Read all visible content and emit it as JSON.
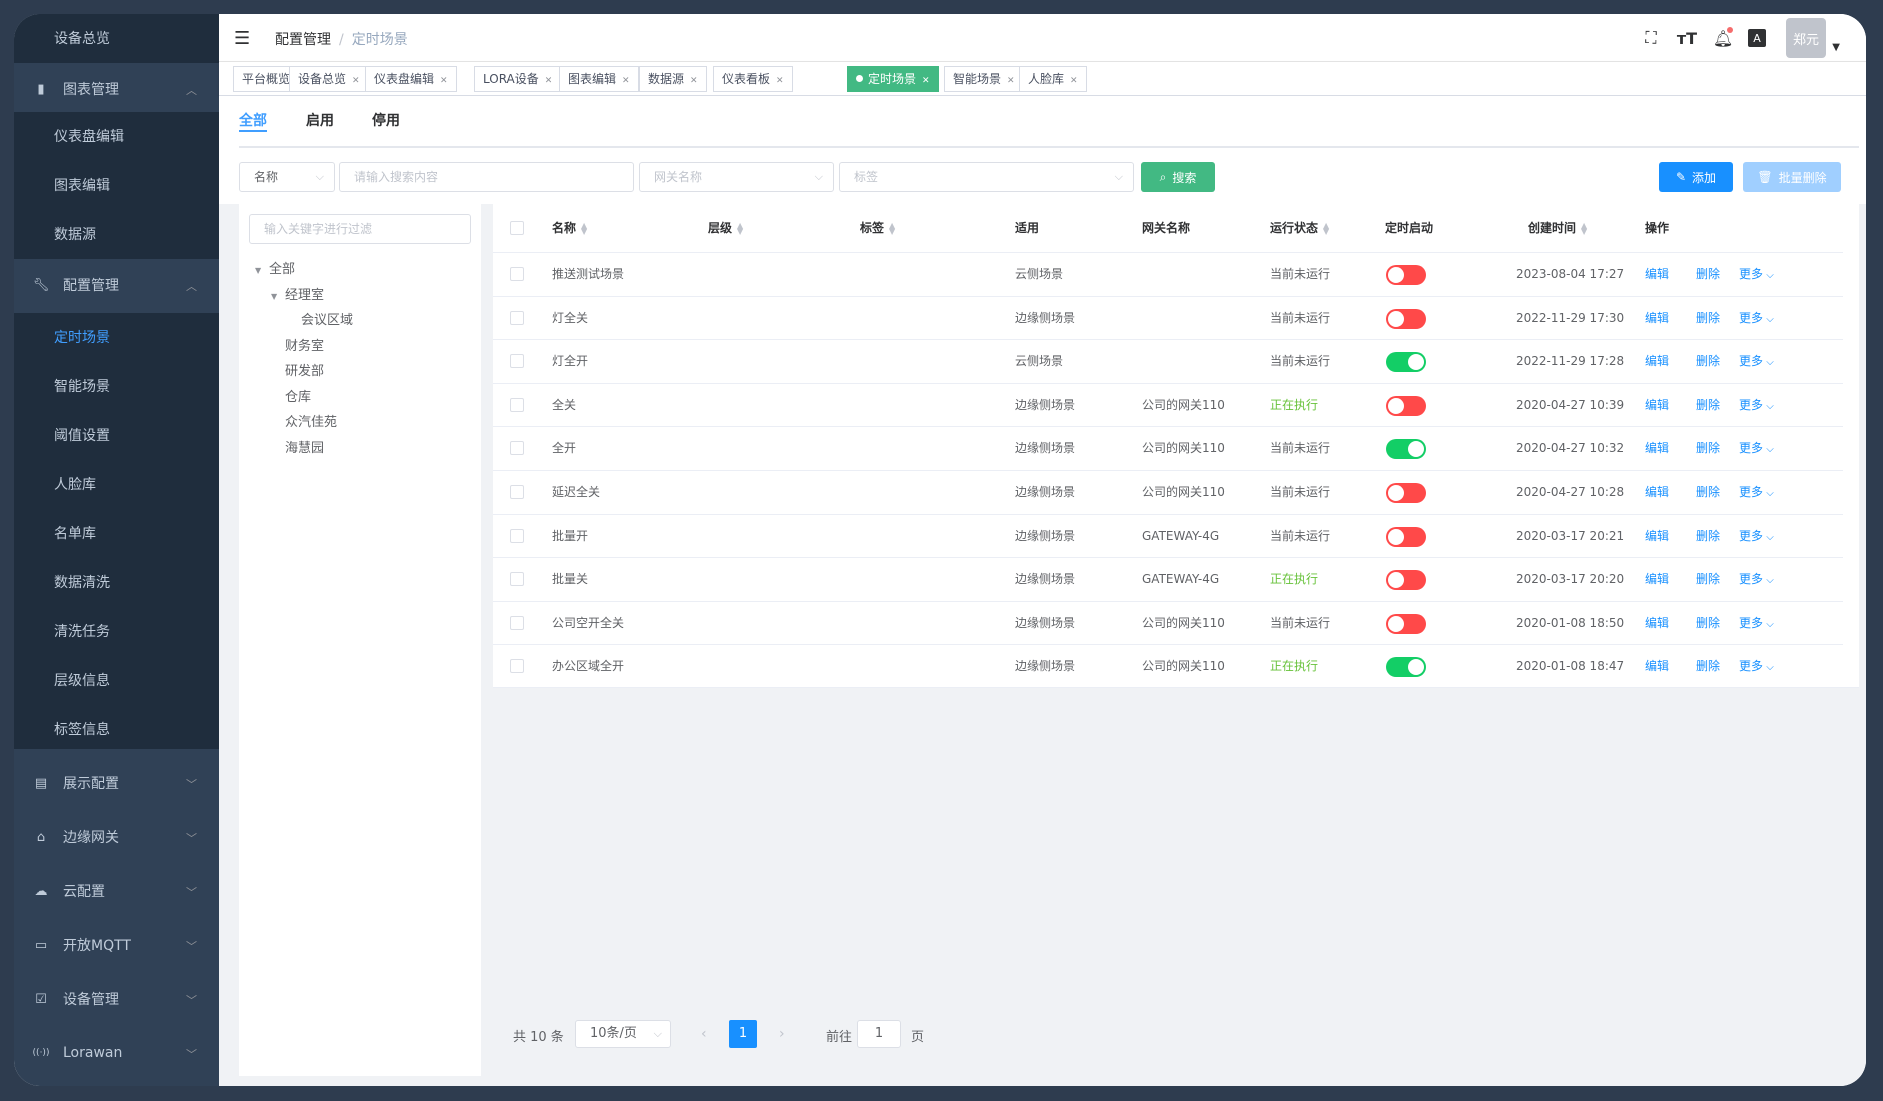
{
  "sidebar": {
    "items": [
      {
        "label": "设备总览",
        "type": "sub"
      },
      {
        "label": "图表管理",
        "type": "top",
        "icon": "bar-chart-icon",
        "expanded": true
      },
      {
        "label": "仪表盘编辑",
        "type": "sub"
      },
      {
        "label": "图表编辑",
        "type": "sub"
      },
      {
        "label": "数据源",
        "type": "sub"
      },
      {
        "label": "配置管理",
        "type": "top",
        "icon": "wrench-icon",
        "expanded": true
      },
      {
        "label": "定时场景",
        "type": "sub",
        "active": true
      },
      {
        "label": "智能场景",
        "type": "sub"
      },
      {
        "label": "阈值设置",
        "type": "sub"
      },
      {
        "label": "人脸库",
        "type": "sub"
      },
      {
        "label": "名单库",
        "type": "sub"
      },
      {
        "label": "数据清洗",
        "type": "sub"
      },
      {
        "label": "清洗任务",
        "type": "sub"
      },
      {
        "label": "层级信息",
        "type": "sub"
      },
      {
        "label": "标签信息",
        "type": "sub"
      },
      {
        "label": "展示配置",
        "type": "top",
        "icon": "display-icon",
        "expanded": false
      },
      {
        "label": "边缘网关",
        "type": "top",
        "icon": "router-icon",
        "expanded": false
      },
      {
        "label": "云配置",
        "type": "top",
        "icon": "cloud-icon",
        "expanded": false
      },
      {
        "label": "开放MQTT",
        "type": "top",
        "icon": "server-icon",
        "expanded": false
      },
      {
        "label": "设备管理",
        "type": "top",
        "icon": "device-check-icon",
        "expanded": false
      },
      {
        "label": "Lorawan",
        "type": "top",
        "icon": "signal-icon",
        "expanded": false
      }
    ]
  },
  "navbar": {
    "breadcrumb": [
      "配置管理",
      "定时场景"
    ],
    "user": "郑元"
  },
  "tags": [
    {
      "label": "平台概览",
      "closable": false
    },
    {
      "label": "设备总览",
      "closable": true
    },
    {
      "label": "仪表盘编辑",
      "closable": true
    },
    {
      "label": "LORA设备",
      "closable": true
    },
    {
      "label": "图表编辑",
      "closable": true
    },
    {
      "label": "数据源",
      "closable": true
    },
    {
      "label": "仪表看板",
      "closable": true
    },
    {
      "label": "定时场景",
      "closable": true,
      "active": true
    },
    {
      "label": "智能场景",
      "closable": true
    },
    {
      "label": "人脸库",
      "closable": true
    }
  ],
  "tabs": [
    "全部",
    "启用",
    "停用"
  ],
  "search": {
    "field_select": "名称",
    "keyword_placeholder": "请输入搜索内容",
    "gateway_placeholder": "网关名称",
    "tag_placeholder": "标签",
    "search_label": "搜索",
    "add_label": "添加",
    "batch_delete_label": "批量删除"
  },
  "tree": {
    "filter_placeholder": "输入关键字进行过滤",
    "nodes": [
      {
        "label": "全部",
        "level": 0,
        "expanded": true
      },
      {
        "label": "经理室",
        "level": 1,
        "expanded": true
      },
      {
        "label": "会议区域",
        "level": 2
      },
      {
        "label": "财务室",
        "level": 1
      },
      {
        "label": "研发部",
        "level": 1
      },
      {
        "label": "仓库",
        "level": 1
      },
      {
        "label": "众汽佳苑",
        "level": 1
      },
      {
        "label": "海慧园",
        "level": 1
      }
    ]
  },
  "table": {
    "headers": [
      "名称",
      "层级",
      "标签",
      "适用",
      "网关名称",
      "运行状态",
      "定时启动",
      "创建时间",
      "操作"
    ],
    "rows": [
      {
        "name": "推送测试场景",
        "level": "",
        "tag": "",
        "scope": "云侧场景",
        "gateway": "",
        "status": "当前未运行",
        "enabled": false,
        "created": "2023-08-04 17:27"
      },
      {
        "name": "灯全关",
        "level": "",
        "tag": "",
        "scope": "边缘侧场景",
        "gateway": "",
        "status": "当前未运行",
        "enabled": false,
        "created": "2022-11-29 17:30"
      },
      {
        "name": "灯全开",
        "level": "",
        "tag": "",
        "scope": "云侧场景",
        "gateway": "",
        "status": "当前未运行",
        "enabled": true,
        "created": "2022-11-29 17:28"
      },
      {
        "name": "全关",
        "level": "",
        "tag": "",
        "scope": "边缘侧场景",
        "gateway": "公司的网关110",
        "status": "正在执行",
        "enabled": false,
        "created": "2020-04-27 10:39"
      },
      {
        "name": "全开",
        "level": "",
        "tag": "",
        "scope": "边缘侧场景",
        "gateway": "公司的网关110",
        "status": "当前未运行",
        "enabled": true,
        "created": "2020-04-27 10:32"
      },
      {
        "name": "延迟全关",
        "level": "",
        "tag": "",
        "scope": "边缘侧场景",
        "gateway": "公司的网关110",
        "status": "当前未运行",
        "enabled": false,
        "created": "2020-04-27 10:28"
      },
      {
        "name": "批量开",
        "level": "",
        "tag": "",
        "scope": "边缘侧场景",
        "gateway": "GATEWAY-4G",
        "status": "当前未运行",
        "enabled": false,
        "created": "2020-03-17 20:21"
      },
      {
        "name": "批量关",
        "level": "",
        "tag": "",
        "scope": "边缘侧场景",
        "gateway": "GATEWAY-4G",
        "status": "正在执行",
        "enabled": false,
        "created": "2020-03-17 20:20"
      },
      {
        "name": "公司空开全关",
        "level": "",
        "tag": "",
        "scope": "边缘侧场景",
        "gateway": "公司的网关110",
        "status": "当前未运行",
        "enabled": false,
        "created": "2020-01-08 18:50"
      },
      {
        "name": "办公区域全开",
        "level": "",
        "tag": "",
        "scope": "边缘侧场景",
        "gateway": "公司的网关110",
        "status": "正在执行",
        "enabled": true,
        "created": "2020-01-08 18:47"
      }
    ],
    "actions": {
      "edit": "编辑",
      "delete": "删除",
      "more": "更多"
    }
  },
  "pagination": {
    "total_text": "共 10 条",
    "page_size": "10条/页",
    "current_page": "1",
    "goto_prefix": "前往",
    "goto_value": "1",
    "goto_suffix": "页"
  },
  "colors": {
    "sidebar_bg": "#304156",
    "sidebar_sub_bg": "#1f2d3d",
    "primary": "#1890ff",
    "success": "#42b983",
    "switch_on": "#13ce66",
    "switch_off": "#ff4949"
  }
}
